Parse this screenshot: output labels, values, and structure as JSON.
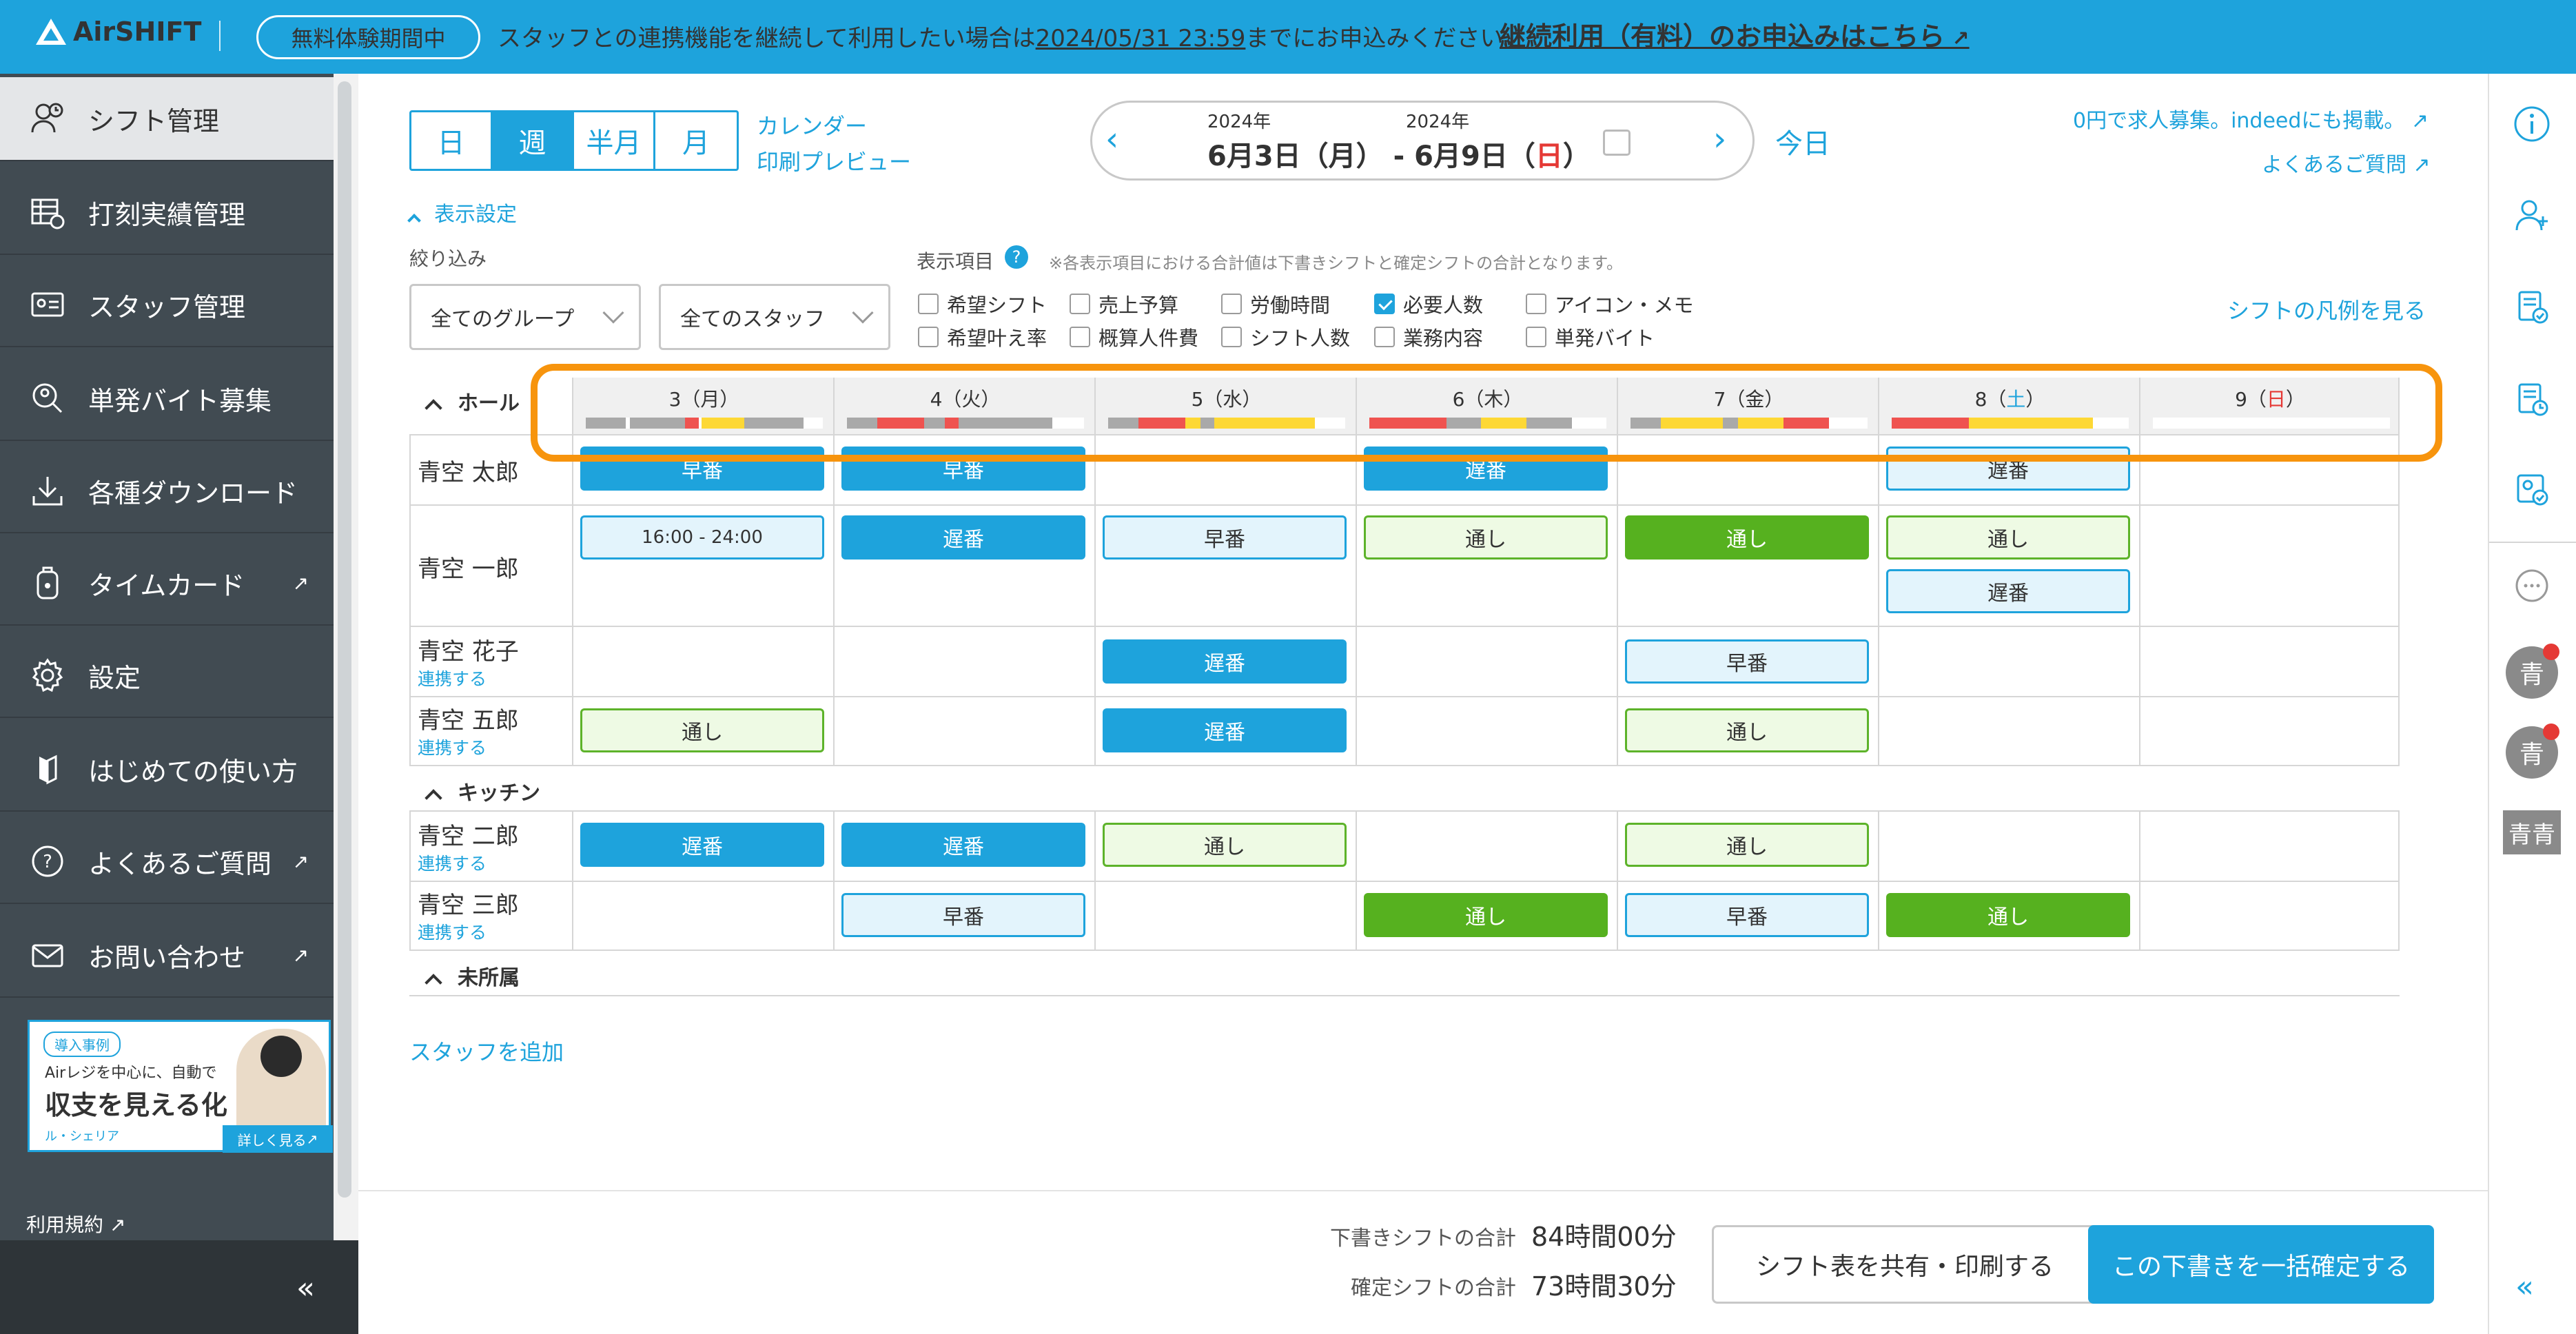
{
  "app": {
    "logo": "AirSHIFT"
  },
  "banner": {
    "trial": "無料体験期間中",
    "text_before": "スタッフとの連携機能を継続して利用したい場合は",
    "date": "2024/05/31 23:59",
    "text_after": "までにお申込みください。",
    "link": "継続利用（有料）のお申込みはこちら"
  },
  "sidebar": {
    "items": [
      {
        "label": "シフト管理",
        "icon": "shift-icon"
      },
      {
        "label": "打刻実績管理",
        "icon": "timecard-table-icon"
      },
      {
        "label": "スタッフ管理",
        "icon": "staff-card-icon"
      },
      {
        "label": "単発バイト募集",
        "icon": "search-person-icon"
      },
      {
        "label": "各種ダウンロード",
        "icon": "download-icon"
      },
      {
        "label": "タイムカード",
        "icon": "timecard-icon"
      },
      {
        "label": "設定",
        "icon": "gear-icon"
      },
      {
        "label": "はじめての使い方",
        "icon": "guide-icon"
      },
      {
        "label": "よくあるご質問",
        "icon": "question-icon"
      },
      {
        "label": "お問い合わせ",
        "icon": "mail-icon"
      }
    ],
    "promo": {
      "tag": "導入事例",
      "line1": "Airレジを中心に、自動で",
      "line2": "収支を見える化",
      "brand": "ル・シェリア",
      "button": "詳しく見る"
    },
    "terms": "利用規約",
    "collapse": "«"
  },
  "toolbar": {
    "view_tabs": [
      "日",
      "週",
      "半月",
      "月"
    ],
    "calendar_link": "カレンダー",
    "print_link": "印刷プレビュー",
    "date_range": {
      "start_year": "2024年",
      "end_year": "2024年",
      "start": "6月3日（月）",
      "sep": "-",
      "end_prefix": "6月9日（",
      "end_day": "日",
      "end_suffix": "）"
    },
    "today": "今日",
    "ad_link": "0円で求人募集。indeedにも掲載。",
    "faq_link": "よくあるご質問"
  },
  "filters": {
    "toggle": "表示設定",
    "filter_label": "絞り込み",
    "group_select": "全てのグループ",
    "staff_select": "全てのスタッフ",
    "display_label": "表示項目",
    "note": "※各表示項目における合計値は下書きシフトと確定シフトの合計となります。",
    "checkboxes": [
      {
        "label": "希望シフト",
        "checked": false
      },
      {
        "label": "売上予算",
        "checked": false
      },
      {
        "label": "労働時間",
        "checked": false
      },
      {
        "label": "必要人数",
        "checked": true
      },
      {
        "label": "アイコン・メモ",
        "checked": false
      },
      {
        "label": "希望叶え率",
        "checked": false
      },
      {
        "label": "概算人件費",
        "checked": false
      },
      {
        "label": "シフト人数",
        "checked": false
      },
      {
        "label": "業務内容",
        "checked": false
      },
      {
        "label": "単発バイト",
        "checked": false
      }
    ],
    "legend_link": "シフトの凡例を見る"
  },
  "grid": {
    "days": [
      {
        "num": "3",
        "open": "（",
        "dow": "月",
        "close": "）"
      },
      {
        "num": "4",
        "open": "（",
        "dow": "火",
        "close": "）"
      },
      {
        "num": "5",
        "open": "（",
        "dow": "水",
        "close": "）"
      },
      {
        "num": "6",
        "open": "（",
        "dow": "木",
        "close": "）"
      },
      {
        "num": "7",
        "open": "（",
        "dow": "金",
        "close": "）"
      },
      {
        "num": "8",
        "open": "（",
        "dow": "土",
        "close": "）"
      },
      {
        "num": "9",
        "open": "（",
        "dow": "日",
        "close": "）"
      }
    ],
    "groups": {
      "hall": "ホール",
      "kitchen": "キッチン",
      "unassigned": "未所属"
    },
    "staff": [
      {
        "name": "青空 太郎",
        "connect": ""
      },
      {
        "name": "青空 一郎",
        "connect": ""
      },
      {
        "name": "青空 花子",
        "connect": "連携する"
      },
      {
        "name": "青空 五郎",
        "connect": "連携する"
      },
      {
        "name": "青空 二郎",
        "connect": "連携する"
      },
      {
        "name": "青空 三郎",
        "connect": "連携する"
      }
    ],
    "shifts": {
      "early": "早番",
      "late": "遅番",
      "through": "通し",
      "custom": "16:00 - 24:00"
    },
    "add_staff": "スタッフを追加"
  },
  "footer": {
    "draft_label": "下書きシフトの合計",
    "draft_value": "84時間00分",
    "confirmed_label": "確定シフトの合計",
    "confirmed_value": "73時間30分",
    "share_button": "シフト表を共有・印刷する",
    "confirm_button": "この下書きを一括確定する"
  },
  "rail": {
    "avatar1": "青",
    "avatar2": "青",
    "avatar3": "青青",
    "collapse": "«"
  },
  "colors": {
    "accent": "#1ea3dc",
    "highlight": "#f7940d",
    "bar_gray": "#a9a9a9",
    "bar_red": "#ef5350",
    "bar_yellow": "#fdd835"
  }
}
